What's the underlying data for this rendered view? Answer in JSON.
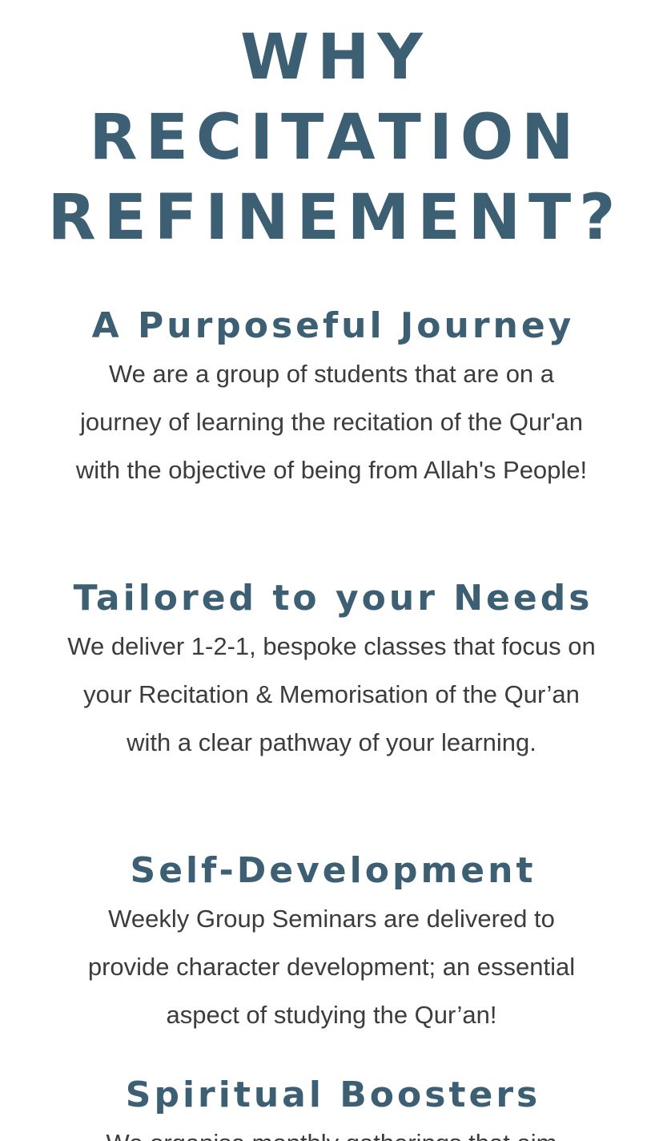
{
  "header": {
    "title_lines": [
      "WHY",
      "RECITATION",
      "REFINEMENT?"
    ]
  },
  "sections": [
    {
      "heading": "A Purposeful Journey",
      "body": "We are a group of students that are on a journey of learning the recitation of the Qur'an with the objective of being from Allah's People!"
    },
    {
      "heading": "Tailored to your Needs",
      "body": "We deliver 1-2-1, bespoke classes that focus on your Recitation & Memorisation of the Qur’an with a clear pathway of your learning."
    },
    {
      "heading": "Self-Development",
      "body": "Weekly Group Seminars are delivered to provide character development; an essential aspect of studying the Qur’an!"
    },
    {
      "heading": "Spiritual Boosters",
      "body": "We organise monthly gatherings that aim"
    }
  ],
  "colors": {
    "heading": "#3d5f73",
    "body_text": "#3c3c3c",
    "background": "#ffffff"
  }
}
